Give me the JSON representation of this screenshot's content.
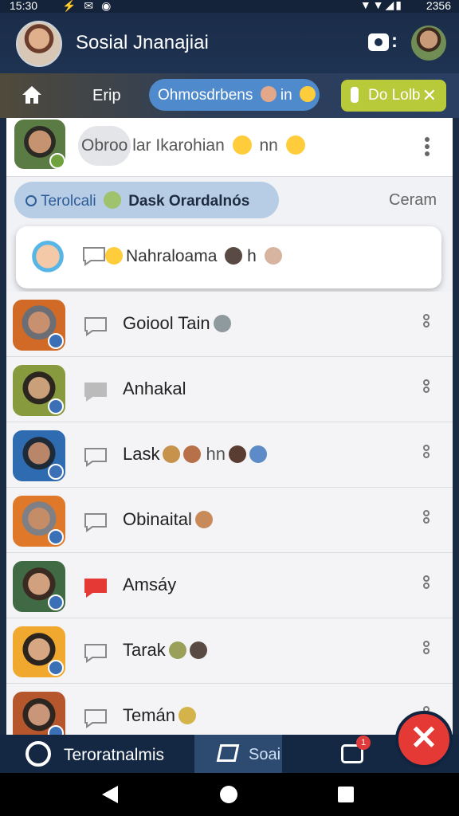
{
  "status_bar": {
    "time": "15:30",
    "battery": "2356"
  },
  "header": {
    "title": "Sosial Jnanajiai"
  },
  "filters": {
    "tab_label": "Erip",
    "active_chip": "Ohmosdrbens",
    "active_chip_suffix": "in",
    "yellow_chip": "Do Lolb"
  },
  "chat_list": {
    "first_preview": "Obroo lar Ikarohian",
    "first_preview_end": "nn",
    "section_label_1": "Terolcali",
    "section_label_2": "Dask Orardalnós",
    "section_right": "Ceram",
    "pinned_name": "Nahraloama",
    "pinned_suffix": "h",
    "rows": [
      {
        "name": "Goiool Tain",
        "suffix": ""
      },
      {
        "name": "Anhakal",
        "suffix": ""
      },
      {
        "name": "Lask",
        "suffix": "hn"
      },
      {
        "name": "Obinaital",
        "suffix": ""
      },
      {
        "name": "Amsáy",
        "suffix": ""
      },
      {
        "name": "Tarak",
        "suffix": ""
      },
      {
        "name": "Temán",
        "suffix": ""
      }
    ]
  },
  "bottom_nav": {
    "tab1_label": "Teroratnalmis",
    "tab2_label": "Soai",
    "camera_badge": "1"
  },
  "colors": {
    "accent": "#4f8bcc",
    "close": "#e53935",
    "header_bg": "#1a2c48"
  }
}
